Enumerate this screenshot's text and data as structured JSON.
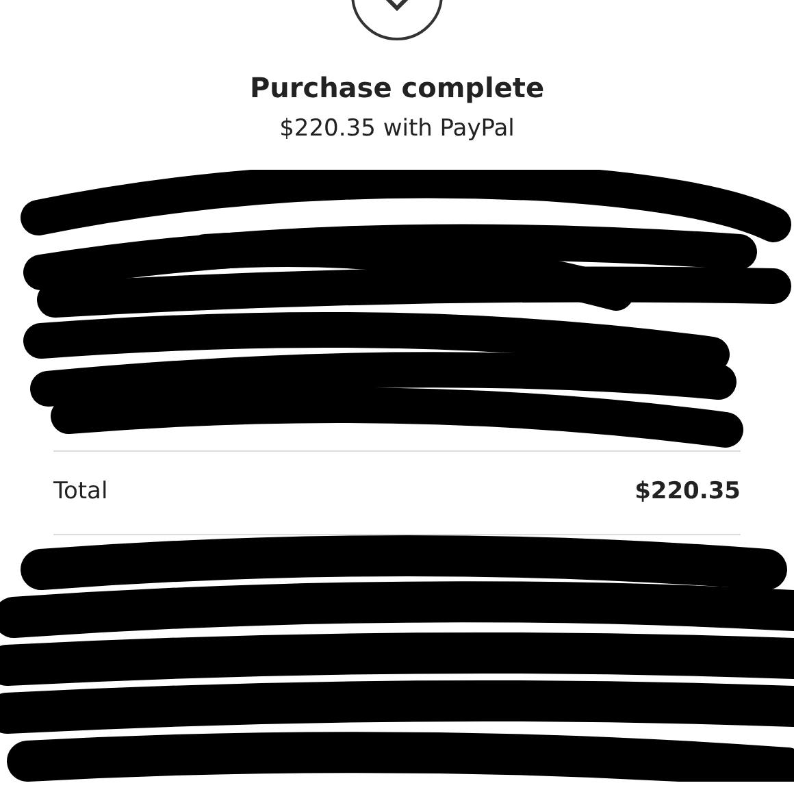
{
  "status": {
    "title": "Purchase complete",
    "subtitle": "$220.35 with PayPal"
  },
  "total": {
    "label": "Total",
    "amount": "$220.35"
  }
}
